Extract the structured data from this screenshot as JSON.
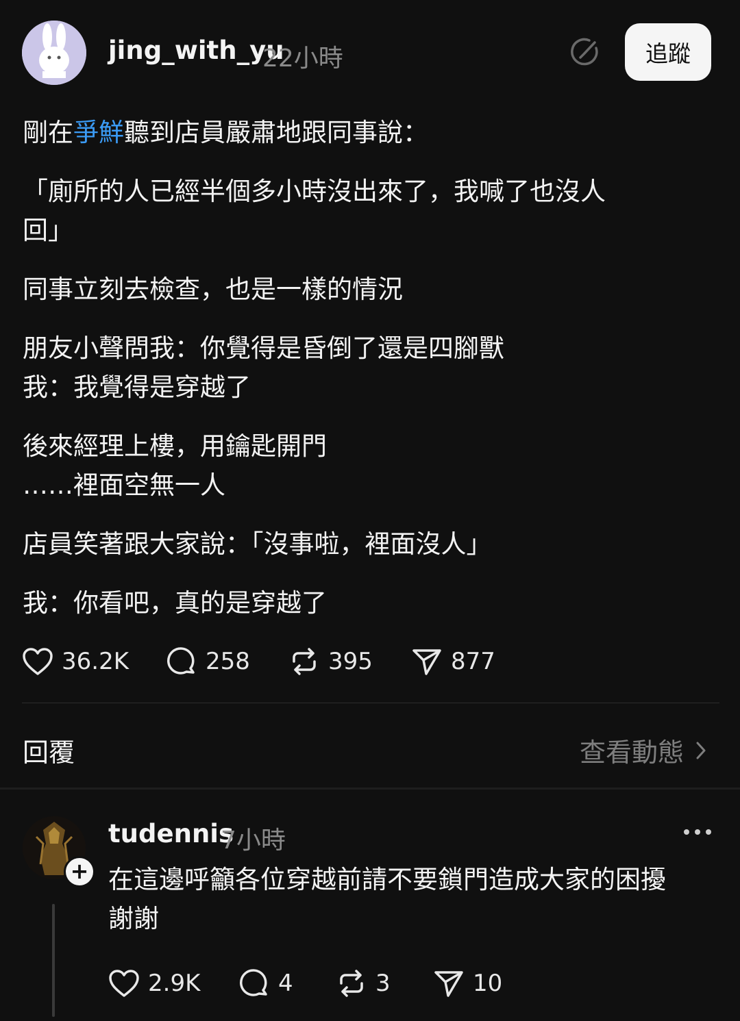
{
  "post": {
    "username": "jing_with_yu",
    "time": "22小時",
    "follow_label": "追蹤",
    "line1_pre": "剛在",
    "line1_link": "爭鮮",
    "line1_post": "聽到店員嚴肅地跟同事說：",
    "line2a": "「廁所的人已經半個多小時沒出來了，我喊了也沒人",
    "line2b": "回」",
    "line3": "同事立刻去檢查，也是一樣的情況",
    "line4a": "朋友小聲問我：你覺得是昏倒了還是四腳獸",
    "line4b": "我：我覺得是穿越了",
    "line5a": "後來經理上樓，用鑰匙開門",
    "line5b": "……裡面空無一人",
    "line6": "店員笑著跟大家說：「沒事啦，裡面沒人」",
    "line7": "我：你看吧，真的是穿越了",
    "stats": {
      "likes": "36.2K",
      "comments": "258",
      "reposts": "395",
      "shares": "877"
    }
  },
  "replies_section": {
    "label": "回覆",
    "activity_label": "查看動態"
  },
  "reply": {
    "username": "tudennis",
    "time": "7小時",
    "line1": "在這邊呼籲各位穿越前請不要鎖門造成大家的困擾",
    "line2": "謝謝",
    "stats": {
      "likes": "2.9K",
      "comments": "4",
      "reposts": "3",
      "shares": "10"
    }
  },
  "icons": {
    "like": "heart-icon",
    "comment": "comment-bubble-icon",
    "repost": "repost-icon",
    "share": "send-icon",
    "edit": "edit-icon",
    "more": "more-icon",
    "chevron": "chevron-right-icon",
    "plus": "plus-icon"
  },
  "colors": {
    "background": "#101010",
    "text": "#f3f3f3",
    "muted": "#8a8a8a",
    "link": "#3b9bf5"
  }
}
